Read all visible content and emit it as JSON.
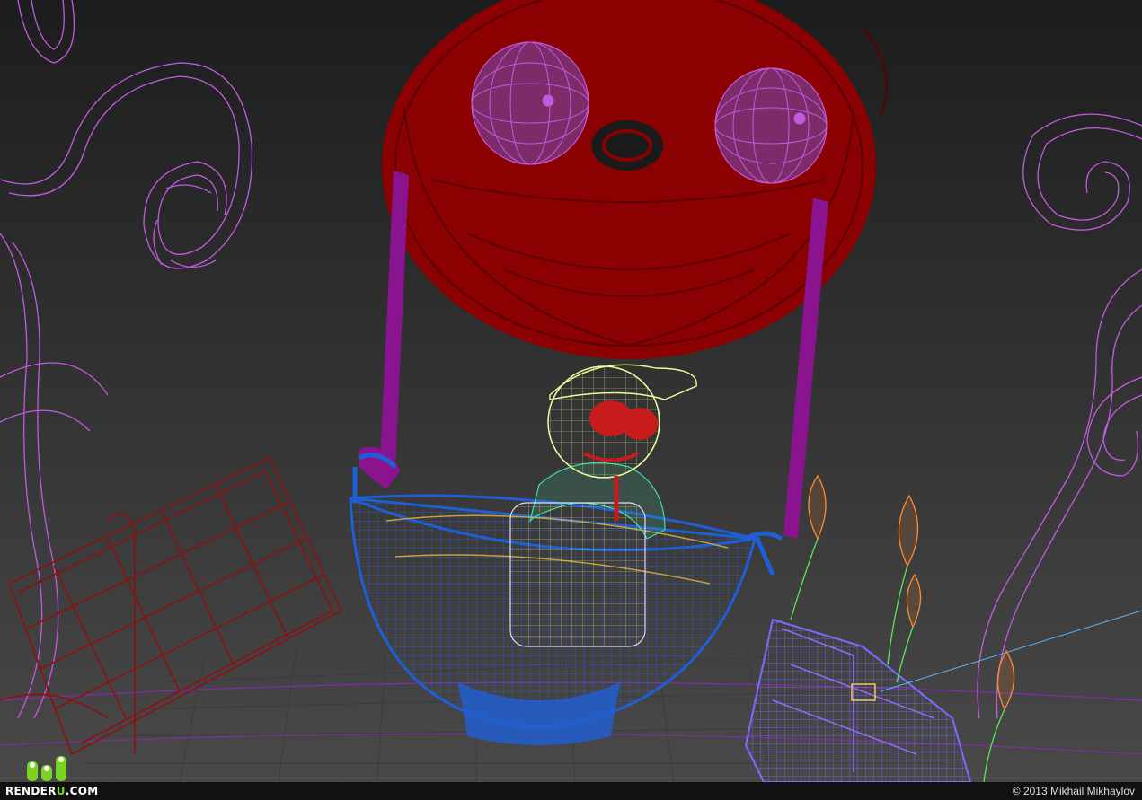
{
  "watermark": {
    "brand": "RENDERU.COM",
    "brand_prefix": "RENDER",
    "brand_accent": "U",
    "brand_suffix": ".COM",
    "credit": "© 2013 Mikhail Mikhaylov"
  },
  "colors": {
    "background_top": "#1d1d1d",
    "background_bottom": "#4a4a4a",
    "balloon_red": "#8b0000",
    "basket_blue": "#1f5fd6",
    "wire_magenta": "#c25be0",
    "rope_purple": "#8a1390",
    "head_yellow": "#f2ffa0",
    "body_green": "#3fe0a0",
    "table_red": "#8e1010",
    "mini_balloon_orange": "#ff8a30",
    "string_green": "#57e85a",
    "logo_green": "#7bd321"
  }
}
